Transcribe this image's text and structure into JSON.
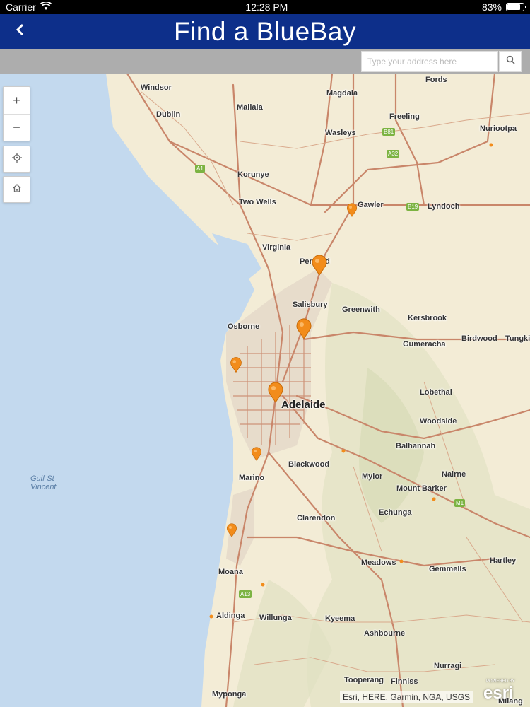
{
  "status": {
    "carrier": "Carrier",
    "time": "12:28 PM",
    "battery": "83%",
    "battery_level": 0.83
  },
  "nav": {
    "title": "Find a BlueBay",
    "back_icon": "chevron-left-icon"
  },
  "search": {
    "placeholder": "Type your address here",
    "value": "",
    "button_icon": "search-icon"
  },
  "map_controls": {
    "zoom_in": "+",
    "zoom_out": "−",
    "locate_icon": "crosshair-icon",
    "home_icon": "home-icon"
  },
  "places": [
    "Windsor",
    "Magdala",
    "Fords",
    "Dublin",
    "Mallala",
    "Freeling",
    "Wasleys",
    "Nuriootpa",
    "Korunye",
    "Two Wells",
    "Gawler",
    "Lyndoch",
    "Virginia",
    "Penfield",
    "Salisbury",
    "Greenwith",
    "Osborne",
    "Kersbrook",
    "Gumeracha",
    "Birdwood",
    "Tungkillo",
    "Adelaide",
    "Lobethal",
    "Woodside",
    "Balhannah",
    "Blackwood",
    "Nairne",
    "Marino",
    "Mylor",
    "Mount Barker",
    "Clarendon",
    "Echunga",
    "Meadows",
    "Gemmells",
    "Hartley",
    "Moana",
    "Aldinga",
    "Willunga",
    "Kyeema",
    "Ashbourne",
    "Nurragi",
    "Tooperang",
    "Finniss",
    "Myponga",
    "Milang"
  ],
  "water_label": "Gulf St\nVincent",
  "road_shields": [
    "A1",
    "B81",
    "A32",
    "B19",
    "M1",
    "A13"
  ],
  "attribution": "Esri, HERE, Garmin, NGA, USGS",
  "esri_logo": "esri",
  "esri_powered": "POWERED BY",
  "colors": {
    "nav_bg": "#0d2f8a",
    "pin": "#f28c1b",
    "water": "#c3d9ee",
    "land": "#f3ecd6",
    "road": "#c9866a"
  }
}
